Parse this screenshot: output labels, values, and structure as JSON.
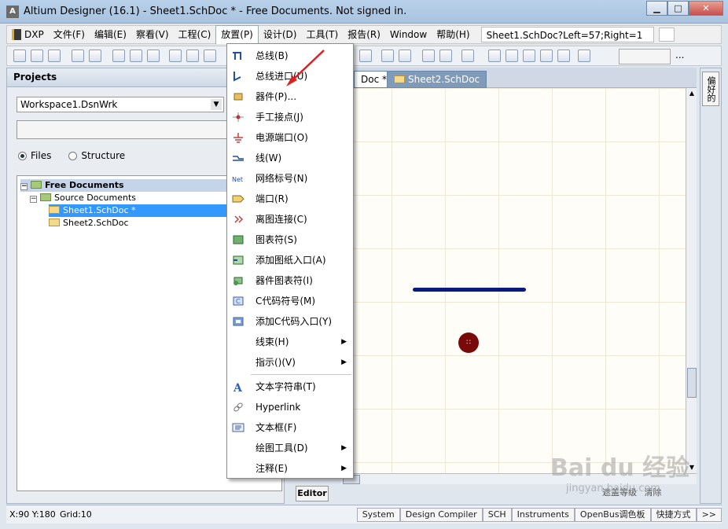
{
  "window": {
    "title": "Altium Designer (16.1) - Sheet1.SchDoc * - Free Documents. Not signed in.",
    "app_icon": "A"
  },
  "menubar": {
    "items": [
      "DXP",
      "文件(F)",
      "编辑(E)",
      "察看(V)",
      "工程(C)",
      "放置(P)",
      "设计(D)",
      "工具(T)",
      "报告(R)",
      "Window",
      "帮助(H)"
    ],
    "active": "放置(P)",
    "address": "Sheet1.SchDoc?Left=57;Right=1"
  },
  "projects_panel": {
    "title": "Projects",
    "workspace": "Workspace1.DsnWrk",
    "view_options": [
      "Files",
      "Structure"
    ],
    "selected_view": "Files",
    "tree": [
      {
        "label": "Free Documents",
        "level": 0,
        "type": "folder"
      },
      {
        "label": "Source Documents",
        "level": 1,
        "type": "folder"
      },
      {
        "label": "Sheet1.SchDoc *",
        "level": 2,
        "type": "doc",
        "selected": true
      },
      {
        "label": "Sheet2.SchDoc",
        "level": 2,
        "type": "doc"
      }
    ]
  },
  "editor": {
    "tabs": [
      "Doc *",
      "Sheet2.SchDoc"
    ],
    "bottom_tab": "Editor",
    "footer": [
      "遮盖等级",
      "清除"
    ],
    "right_panel_tab": "偏好的"
  },
  "place_menu": {
    "items": [
      {
        "label": "总线(B)",
        "icon": "bus-icon"
      },
      {
        "label": "总线进口(U)",
        "icon": "bus-entry-icon"
      },
      {
        "label": "器件(P)...",
        "icon": "part-icon"
      },
      {
        "label": "手工接点(J)",
        "icon": "junction-icon"
      },
      {
        "label": "电源端口(O)",
        "icon": "power-port-icon"
      },
      {
        "label": "线(W)",
        "icon": "wire-icon"
      },
      {
        "label": "网络标号(N)",
        "icon": "net-label-icon"
      },
      {
        "label": "端口(R)",
        "icon": "port-icon"
      },
      {
        "label": "离图连接(C)",
        "icon": "off-sheet-icon"
      },
      {
        "label": "图表符(S)",
        "icon": "sheet-symbol-icon"
      },
      {
        "label": "添加图纸入口(A)",
        "icon": "sheet-entry-icon"
      },
      {
        "label": "器件图表符(I)",
        "icon": "device-sheet-icon"
      },
      {
        "label": "C代码符号(M)",
        "icon": "c-code-icon"
      },
      {
        "label": "添加C代码入口(Y)",
        "icon": "c-code-entry-icon"
      },
      {
        "label": "线束(H)",
        "icon": "",
        "submenu": true
      },
      {
        "label": "指示()(V)",
        "icon": "",
        "submenu": true
      },
      {
        "label": "文本字符串(T)",
        "icon": "text-icon"
      },
      {
        "label": "Hyperlink",
        "icon": "link-icon"
      },
      {
        "label": "文本框(F)",
        "icon": "text-frame-icon"
      },
      {
        "label": "绘图工具(D)",
        "icon": "",
        "submenu": true
      },
      {
        "label": "注释(E)",
        "icon": "",
        "submenu": true
      }
    ]
  },
  "statusbar": {
    "coords": "X:90 Y:180",
    "grid": "Grid:10",
    "buttons": [
      "System",
      "Design Compiler",
      "SCH",
      "Instruments",
      "OpenBus调色板",
      "快捷方式",
      ">>"
    ]
  },
  "watermark": {
    "text": "Bai du 经验",
    "url": "jingyan.baidu.com"
  },
  "colors": {
    "wire": "#0a1a7a",
    "junction": "#7a0a0a",
    "annotation_arrow": "#e02020",
    "selection": "#3399ff"
  }
}
